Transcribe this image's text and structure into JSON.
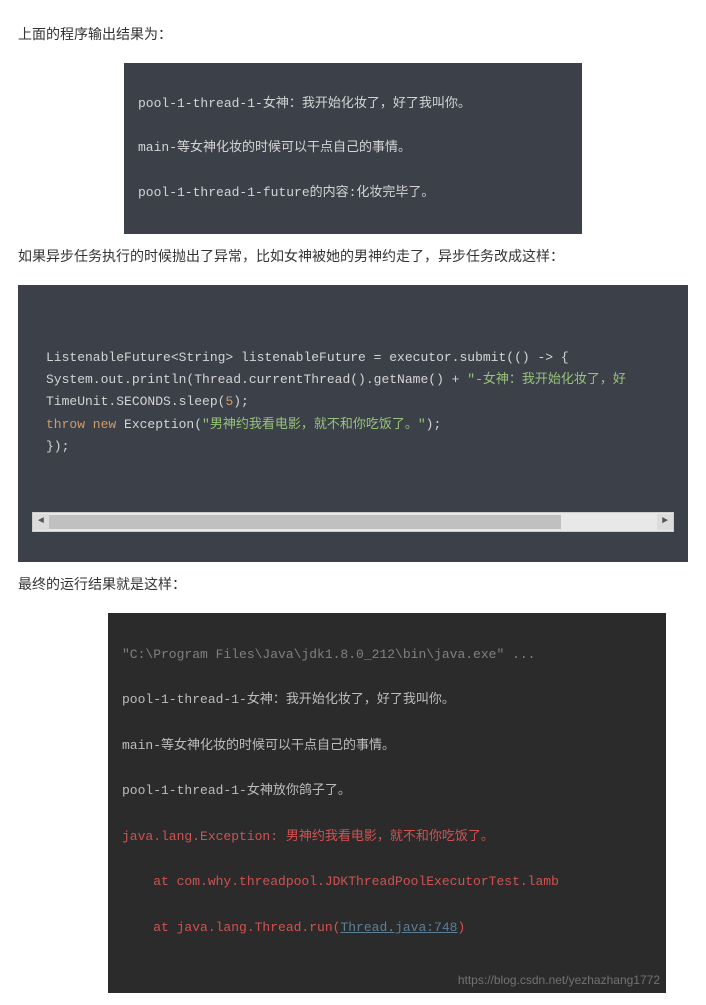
{
  "p1": "上面的程序输出结果为：",
  "out1": {
    "l1": "pool-1-thread-1-女神：我开始化妆了，好了我叫你。",
    "l2": "main-等女神化妆的时候可以干点自己的事情。",
    "l3": "pool-1-thread-1-future的内容:化妆完毕了。"
  },
  "p2": "如果异步任务执行的时候抛出了异常，比如女神被她的男神约走了，异步任务改成这样：",
  "code2": {
    "l1_a": "ListenableFuture<String> listenableFuture = executor.",
    "l1_b": "submit",
    "l1_c": "(() -> {",
    "l2_a": "            System.out.println(Thread.currentThread().getName() + ",
    "l2_b": "\"-女神：我开始化妆了，好",
    "l3_a": "            TimeUnit.SECONDS.sleep(",
    "l3_b": "5",
    "l3_c": ");",
    "l4_a": "            ",
    "l4_b": "throw new",
    "l4_c": " Exception(",
    "l4_d": "\"男神约我看电影，就不和你吃饭了。\"",
    "l4_e": ");",
    "l5": "        });"
  },
  "p3": "最终的运行结果就是这样：",
  "console": {
    "l1": "\"C:\\Program Files\\Java\\jdk1.8.0_212\\bin\\java.exe\" ...",
    "l2": "pool-1-thread-1-女神：我开始化妆了，好了我叫你。",
    "l3": "main-等女神化妆的时候可以干点自己的事情。",
    "l4": "pool-1-thread-1-女神放你鸽子了。",
    "l5": "java.lang.Exception: 男神约我看电影，就不和你吃饭了。",
    "l6_a": "    at com.why.threadpool.JDKThreadPoolExecutorTest.lamb",
    "l7_a": "    at java.lang.Thread.run(",
    "l7_b": "Thread.java:748",
    "l7_c": ")"
  },
  "watermark": "https://blog.csdn.net/yezhazhang1772"
}
